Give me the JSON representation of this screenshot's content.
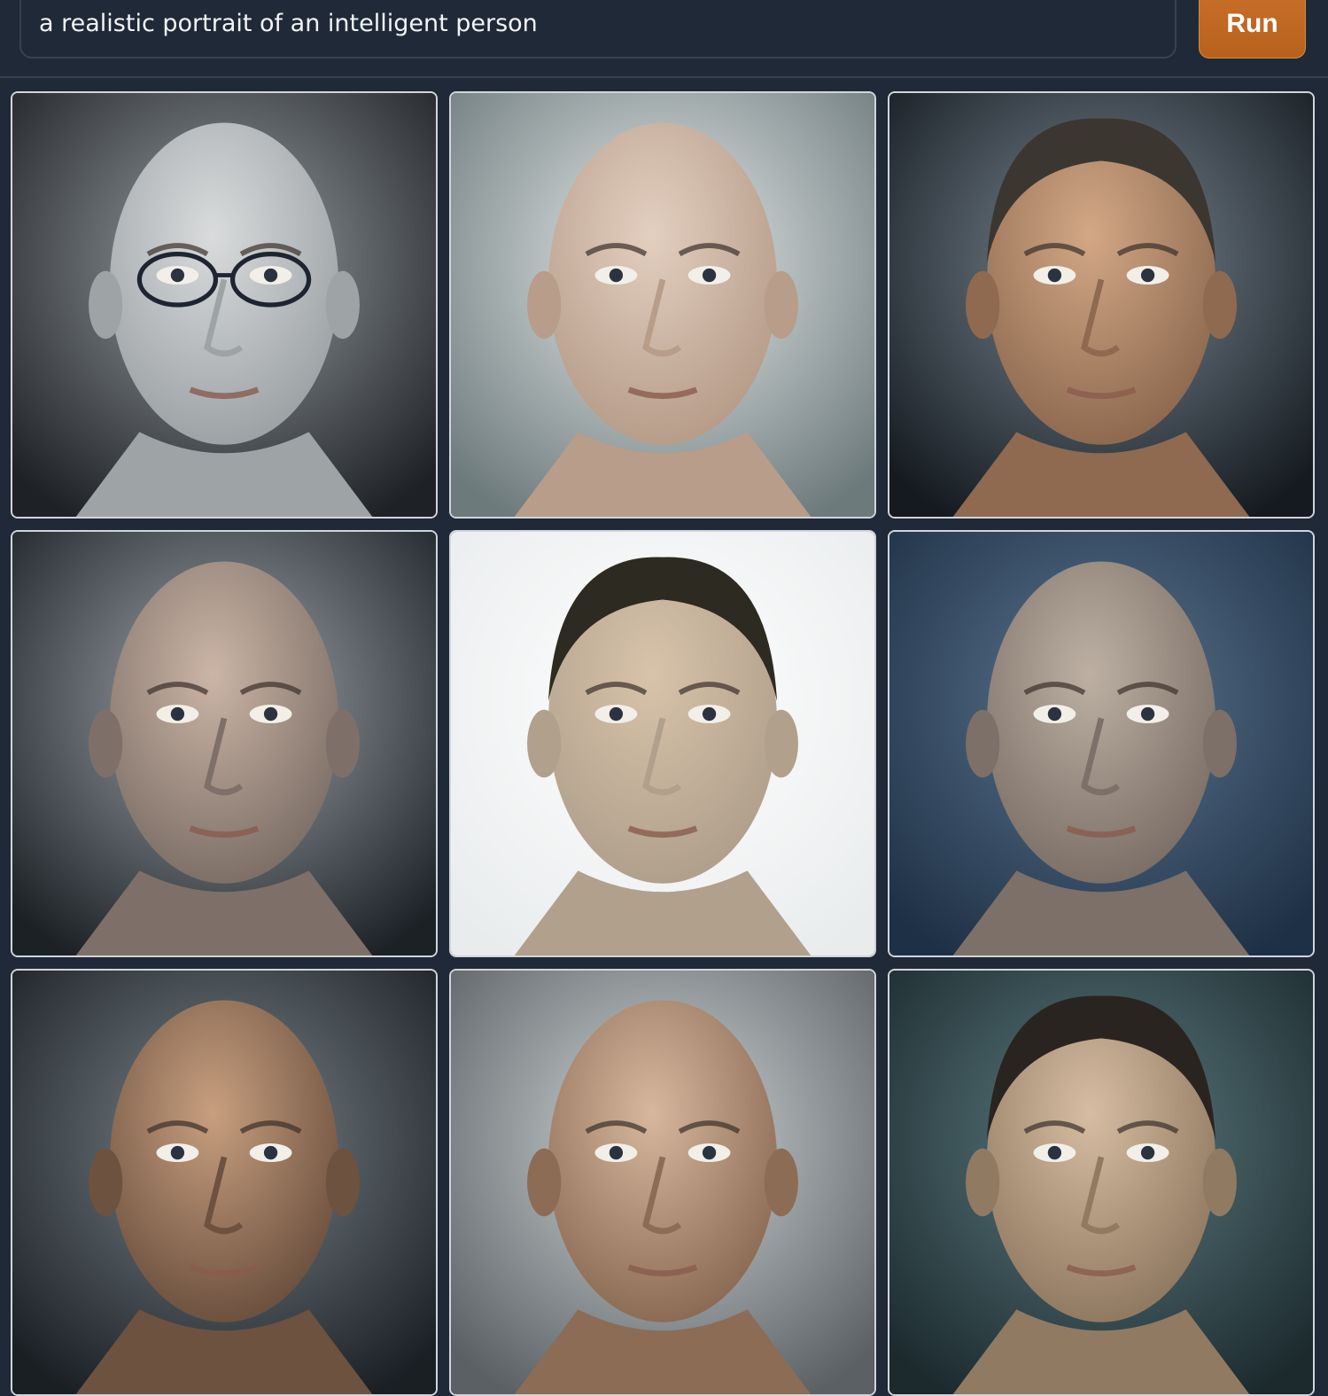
{
  "prompt": {
    "value": "a realistic portrait of an intelligent person"
  },
  "run_button": {
    "label": "Run"
  },
  "colors": {
    "page_bg": "#1f2937",
    "accent": "#c9712b",
    "tile_border": "#d1d5db"
  },
  "gallery": {
    "images": [
      {
        "name": "portrait-1",
        "bg": "#1e2125",
        "bg_light": "#9aa0a4",
        "skin": "#d9dbdc",
        "skin_shadow": "#9ea3a6",
        "hair": "none",
        "glasses": true
      },
      {
        "name": "portrait-2",
        "bg": "#6d7a7c",
        "bg_light": "#e8ecec",
        "skin": "#e3cfc0",
        "skin_shadow": "#b79d8a",
        "hair": "none",
        "glasses": false
      },
      {
        "name": "portrait-3",
        "bg": "#141a20",
        "bg_light": "#7d8a95",
        "skin": "#d2a886",
        "skin_shadow": "#8f6a50",
        "hair": "#3c3630",
        "glasses": false
      },
      {
        "name": "portrait-4",
        "bg": "#1c2126",
        "bg_light": "#a2a8ad",
        "skin": "#cbb5a6",
        "skin_shadow": "#7e7068",
        "hair": "none",
        "glasses": false
      },
      {
        "name": "portrait-5",
        "bg": "#e9eced",
        "bg_light": "#ffffff",
        "skin": "#d8c3aa",
        "skin_shadow": "#b0a08c",
        "hair": "#2d2a22",
        "glasses": false
      },
      {
        "name": "portrait-6",
        "bg": "#1e3045",
        "bg_light": "#5c7690",
        "skin": "#bdb0a3",
        "skin_shadow": "#7c7068",
        "hair": "none",
        "glasses": false
      },
      {
        "name": "portrait-7",
        "bg": "#1a1f24",
        "bg_light": "#7c868c",
        "skin": "#c89f7f",
        "skin_shadow": "#6d5240",
        "hair": "none",
        "glasses": false
      },
      {
        "name": "portrait-8",
        "bg": "#5a6064",
        "bg_light": "#d4d8da",
        "skin": "#d7b79d",
        "skin_shadow": "#8c6c55",
        "hair": "none",
        "glasses": false
      },
      {
        "name": "portrait-9",
        "bg": "#1c2a2e",
        "bg_light": "#5d7d82",
        "skin": "#d6bda2",
        "skin_shadow": "#917a62",
        "hair": "#2a2420",
        "glasses": false
      }
    ]
  }
}
